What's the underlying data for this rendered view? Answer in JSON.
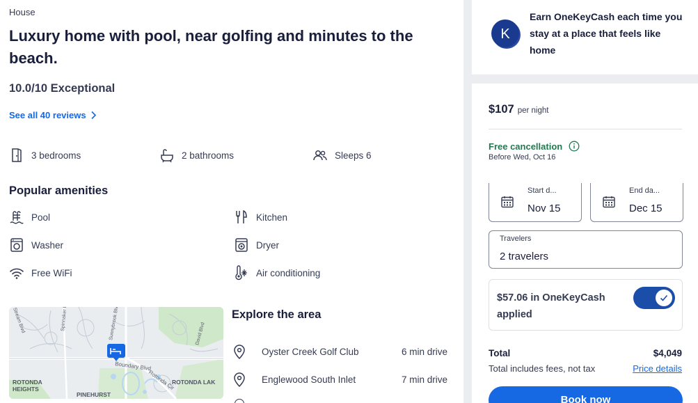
{
  "listing": {
    "type": "House",
    "title": "Luxury home with pool, near golfing and minutes to the beach.",
    "rating": "10.0/10 Exceptional",
    "reviews_link": "See all 40 reviews"
  },
  "facts": {
    "bedrooms": "3 bedrooms",
    "bathrooms": "2 bathrooms",
    "sleeps": "Sleeps 6"
  },
  "amenities": {
    "title": "Popular amenities",
    "items": [
      {
        "label": "Pool",
        "icon": "pool-icon"
      },
      {
        "label": "Kitchen",
        "icon": "kitchen-icon"
      },
      {
        "label": "Washer",
        "icon": "washer-icon"
      },
      {
        "label": "Dryer",
        "icon": "dryer-icon"
      },
      {
        "label": "Free WiFi",
        "icon": "wifi-icon"
      },
      {
        "label": "Air conditioning",
        "icon": "air-conditioning-icon"
      }
    ]
  },
  "map": {
    "labels": [
      "Boundary Blvd",
      "Rotonda Cir",
      "ROTONDA",
      "HEIGHTS",
      "ROTONDA LAK",
      "PINEHURST",
      "Sunnybrook Blvd",
      "Spinnaker Blvd",
      "Stream Blvd",
      "David Blvd"
    ]
  },
  "explore": {
    "title": "Explore the area",
    "places": [
      {
        "name": "Oyster Creek Golf Club",
        "distance": "6 min drive"
      },
      {
        "name": "Englewood South Inlet",
        "distance": "7 min drive"
      }
    ]
  },
  "onekeycash_promo": {
    "logo_letter": "K",
    "text": "Earn OneKeyCash each time you stay at a place that feels like home"
  },
  "booking": {
    "price": "$107",
    "per_night": "per night",
    "free_cancellation": "Free cancellation",
    "before": "Before Wed, Oct 16",
    "start_label": "Start d...",
    "start_value": "Nov 15",
    "end_label": "End da...",
    "end_value": "Dec 15",
    "travelers_label": "Travelers",
    "travelers_value": "2 travelers",
    "onekeycash_applied": "$57.06 in OneKeyCash applied",
    "onekeycash_toggle_on": true,
    "total_label": "Total",
    "total_value": "$4,049",
    "total_note": "Total includes fees, not tax",
    "price_details": "Price details",
    "book_now": "Book now"
  },
  "colors": {
    "link": "#1668e3",
    "brand_dark": "#1a4ea8",
    "success": "#227950",
    "text": "#191e3b",
    "panel_bg": "#ecedf1"
  }
}
